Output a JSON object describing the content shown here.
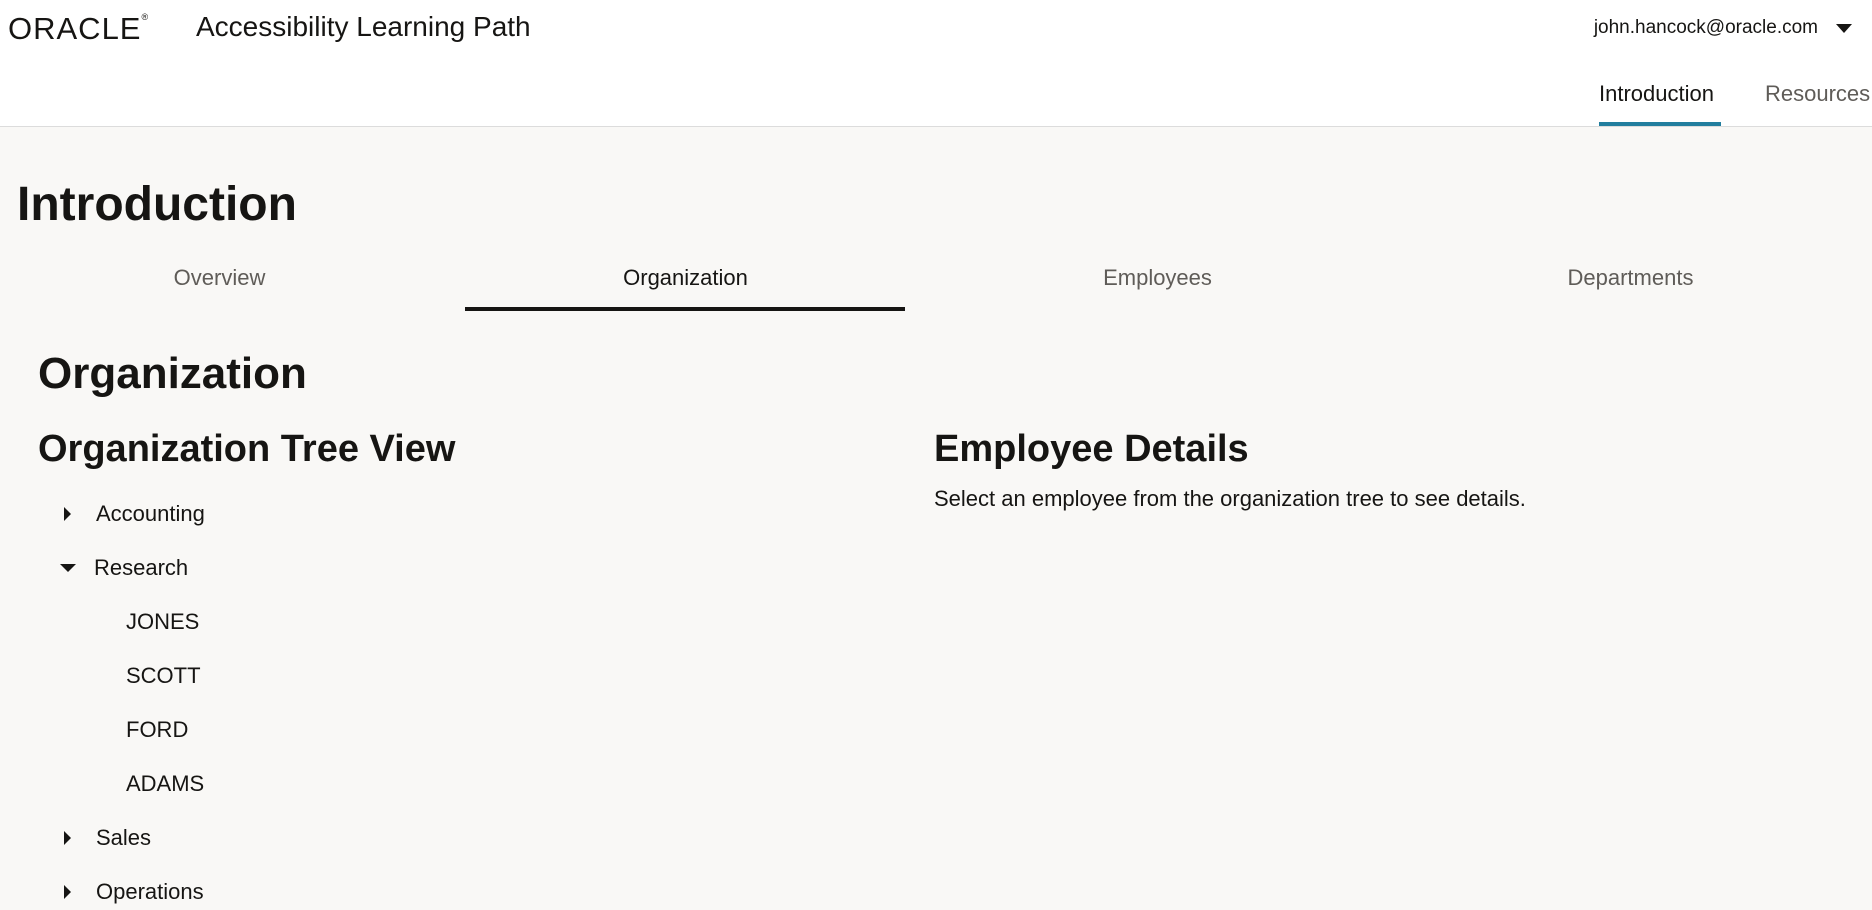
{
  "header": {
    "logo_text": "ORACLE",
    "logo_mark": "®",
    "app_title": "Accessibility Learning Path",
    "user_email": "john.hancock@oracle.com",
    "nav": [
      {
        "label": "Introduction",
        "active": true
      },
      {
        "label": "Resources",
        "active": false
      }
    ]
  },
  "page": {
    "title": "Introduction",
    "subtabs": [
      {
        "label": "Overview",
        "active": false
      },
      {
        "label": "Organization",
        "active": true
      },
      {
        "label": "Employees",
        "active": false
      },
      {
        "label": "Departments",
        "active": false
      }
    ]
  },
  "organization": {
    "section_title": "Organization",
    "tree_heading": "Organization Tree View",
    "tree": [
      {
        "label": "Accounting",
        "expanded": false
      },
      {
        "label": "Research",
        "expanded": true,
        "children": [
          "JONES",
          "SCOTT",
          "FORD",
          "ADAMS"
        ]
      },
      {
        "label": "Sales",
        "expanded": false
      },
      {
        "label": "Operations",
        "expanded": false
      }
    ],
    "details_heading": "Employee Details",
    "details_text": "Select an employee from the organization tree to see details."
  },
  "colors": {
    "nav_active_underline": "#227e9e",
    "subtab_active_underline": "#161513",
    "page_background": "#f9f8f6"
  }
}
